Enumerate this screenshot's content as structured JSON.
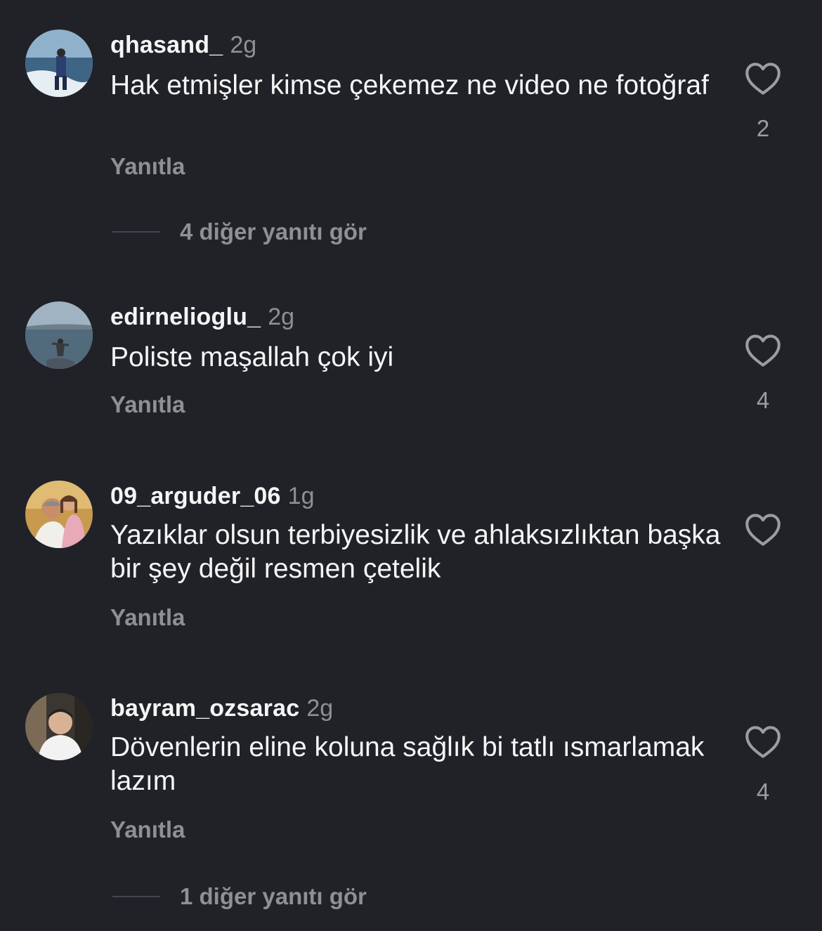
{
  "comments": [
    {
      "username": "qhasand_",
      "time": "2g",
      "text": "Hak etmişler kimse çekemez ne video ne fotoğraf",
      "reply_label": "Yanıtla",
      "likes": "2",
      "view_more": "4 diğer yanıtı gör"
    },
    {
      "username": "edirnelioglu_",
      "time": "2g",
      "text": "Poliste maşallah çok iyi",
      "reply_label": "Yanıtla",
      "likes": "4"
    },
    {
      "username": "09_arguder_06",
      "time": "1g",
      "text": "Yazıklar olsun terbiyesizlik ve ahlaksızlıktan başka bir şey değil resmen çetelik",
      "reply_label": "Yanıtla",
      "likes": ""
    },
    {
      "username": "bayram_ozsarac",
      "time": "2g",
      "text": "Dövenlerin eline koluna sağlık bi tatlı ısmarlamak lazım",
      "reply_label": "Yanıtla",
      "likes": "4",
      "view_more": "1 diğer yanıtı gör"
    }
  ],
  "icons": {
    "like": "heart-outline-icon"
  },
  "colors": {
    "background": "#202228",
    "primary_text": "#f5f5f5",
    "secondary_text": "#8e9096"
  }
}
